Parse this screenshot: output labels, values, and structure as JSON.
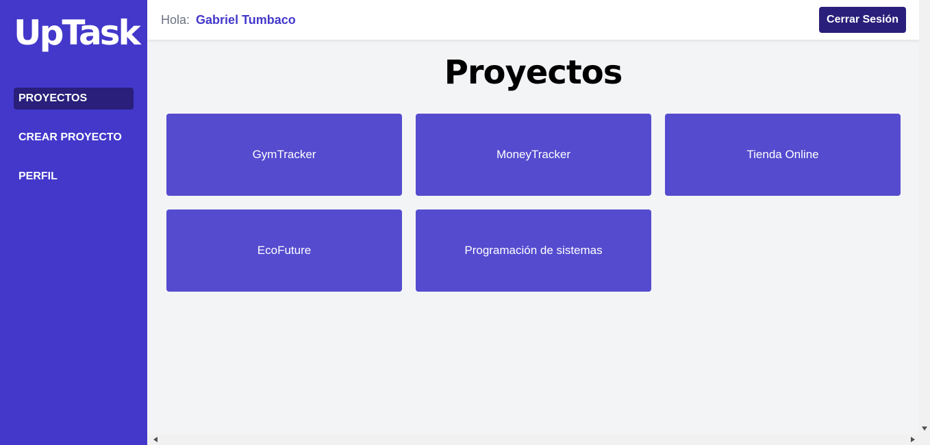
{
  "sidebar": {
    "logo": "UpTask",
    "items": [
      {
        "label": "PROYECTOS",
        "active": true
      },
      {
        "label": "CREAR PROYECTO",
        "active": false
      },
      {
        "label": "PERFIL",
        "active": false
      }
    ]
  },
  "header": {
    "greeting": "Hola:",
    "user_name": "Gabriel Tumbaco",
    "logout_label": "Cerrar Sesión"
  },
  "main": {
    "title": "Proyectos",
    "projects": [
      {
        "name": "GymTracker"
      },
      {
        "name": "MoneyTracker"
      },
      {
        "name": "Tienda Online"
      },
      {
        "name": "EcoFuture"
      },
      {
        "name": "Programación de sistemas"
      }
    ]
  },
  "colors": {
    "sidebar_bg": "#4338ca",
    "active_item_bg": "#2a1f7a",
    "card_bg": "#554bcf",
    "page_bg": "#f3f4f6"
  },
  "icons": {
    "scroll_down": "arrow-down-icon",
    "scroll_left": "arrow-left-icon",
    "scroll_right": "arrow-right-icon"
  }
}
